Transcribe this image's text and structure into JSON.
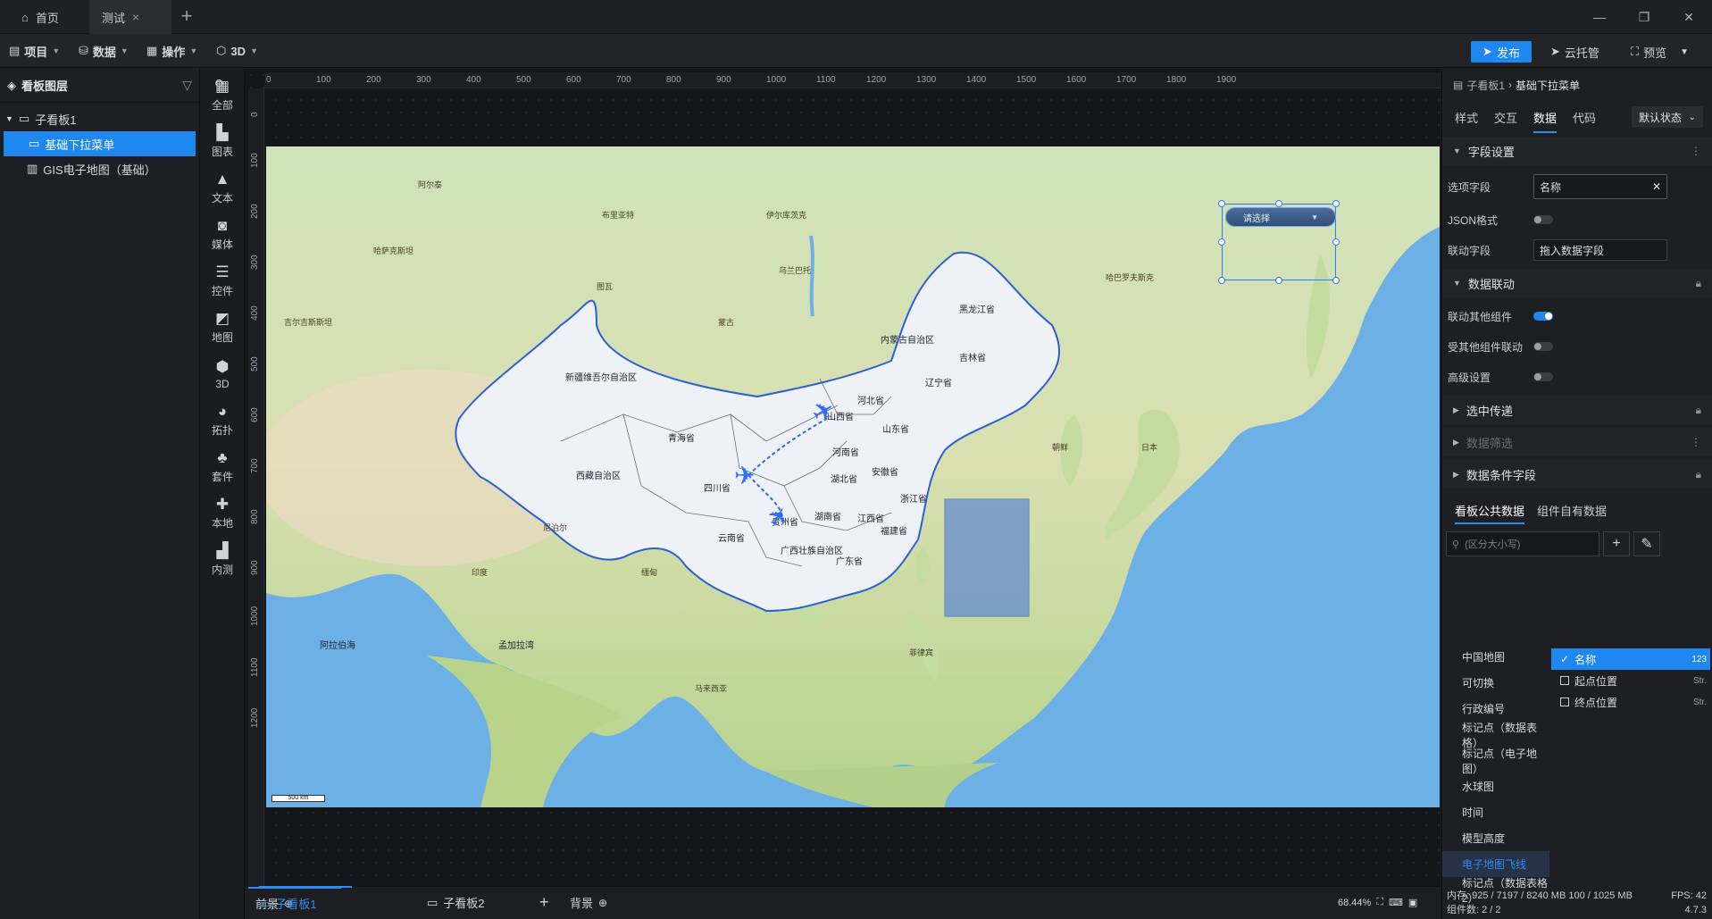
{
  "titlebar": {
    "tabs": [
      {
        "label": "首页"
      },
      {
        "label": "测试"
      }
    ],
    "add": "+",
    "minimize": "—",
    "restore": "❐",
    "close": "✕"
  },
  "toolbar": {
    "menus": [
      "项目",
      "数据",
      "操作",
      "3D"
    ],
    "publish": "发布",
    "cloud": "云托管",
    "preview": "预览"
  },
  "layers": {
    "title": "看板图层",
    "group": "子看板1",
    "items": [
      "基础下拉菜单",
      "GIS电子地图（基础）"
    ]
  },
  "components": [
    "全部",
    "图表",
    "文本",
    "媒体",
    "控件",
    "地图",
    "3D",
    "拓扑",
    "套件",
    "本地",
    "内测"
  ],
  "ruler": {
    "top": [
      "0",
      "100",
      "200",
      "300",
      "400",
      "500",
      "600",
      "700",
      "800",
      "900",
      "1000",
      "1100",
      "1200",
      "1300",
      "1400",
      "1500",
      "1600",
      "1700",
      "1800",
      "1900"
    ],
    "left": [
      "0",
      "100",
      "200",
      "300",
      "400",
      "500",
      "600",
      "700",
      "800",
      "900",
      "1000",
      "1100",
      "1200"
    ]
  },
  "map": {
    "dropdown_placeholder": "请选择",
    "scale": "500 km",
    "provinces": [
      "新疆维吾尔自治区",
      "西藏自治区",
      "青海省",
      "四川省",
      "云南省",
      "内蒙古自治区",
      "黑龙江省",
      "吉林省",
      "辽宁省",
      "河北省",
      "山西省",
      "山东省",
      "河南省",
      "湖北省",
      "安徽省",
      "浙江省",
      "江西省",
      "湖南省",
      "贵州省",
      "福建省",
      "广西壮族自治区",
      "广东省"
    ],
    "places": [
      "阿尔泰",
      "乌兰巴托",
      "布里亚特",
      "伊尔库茨克",
      "图瓦",
      "蒙古",
      "哈萨克斯坦",
      "吉尔吉斯斯坦",
      "印度",
      "缅甸",
      "尼泊尔",
      "阿拉伯海",
      "孟加拉湾",
      "马来西亚",
      "哈巴罗夫斯克",
      "朝鲜",
      "日本",
      "菲律宾"
    ]
  },
  "bottom": {
    "tabs": [
      "前景",
      "子看板1",
      "子看板2",
      "背景"
    ],
    "zoom": "68.44%"
  },
  "props": {
    "breadcrumb": [
      "子看板1",
      "基础下拉菜单"
    ],
    "tabs": [
      "样式",
      "交互",
      "数据",
      "代码"
    ],
    "state": "默认状态",
    "field_section": "字段设置",
    "option_field_label": "选项字段",
    "option_field_value": "名称",
    "json_label": "JSON格式",
    "link_field_label": "联动字段",
    "link_field_placeholder": "拖入数据字段",
    "linkage_section": "数据联动",
    "link_other": "联动其他组件",
    "linked_by_other": "受其他组件联动",
    "advanced": "高级设置",
    "pass_section": "选中传递",
    "filter_section": "数据筛选",
    "cond_section": "数据条件字段",
    "data_tabs": [
      "看板公共数据",
      "组件自有数据"
    ],
    "search_placeholder": "(区分大小写)",
    "datasets": [
      "中国地图",
      "可切换",
      "行政编号",
      "标记点（数据表格）",
      "标记点（电子地图）",
      "水球图",
      "时间",
      "模型高度",
      "电子地图飞线",
      "标记点（数据表格2）"
    ],
    "fields": [
      {
        "name": "名称",
        "type": "123",
        "checked": true
      },
      {
        "name": "起点位置",
        "type": "Str.",
        "checked": false
      },
      {
        "name": "终点位置",
        "type": "Str.",
        "checked": false
      }
    ]
  },
  "status": {
    "memory": "内存:  925 / 7197 / 8240 MB  100 / 1025 MB",
    "fps": "FPS: 42",
    "count": "组件数: 2 / 2",
    "version": "4.7.3"
  },
  "colors": {
    "accent": "#1e88f0",
    "ocean": "#6db0e6",
    "border": "#2b5fd6"
  }
}
